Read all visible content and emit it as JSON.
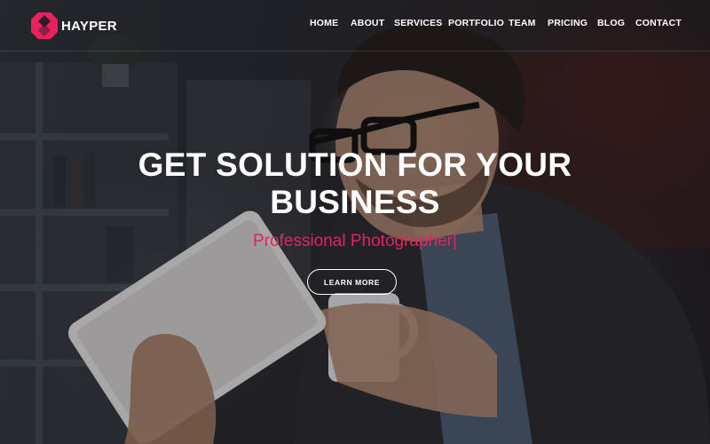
{
  "brand": {
    "name": "HAYPER",
    "logo_icon": "hayper-logo-icon",
    "logo_color": "#e8215f"
  },
  "nav": {
    "items": [
      {
        "label": "HOME"
      },
      {
        "label": "ABOUT"
      },
      {
        "label": "SERVICES"
      },
      {
        "label": "PORTFOLIO"
      },
      {
        "label": "TEAM"
      },
      {
        "label": "PRICING"
      },
      {
        "label": "BLOG"
      },
      {
        "label": "CONTACT"
      }
    ]
  },
  "hero": {
    "headline_line1": "GET SOLUTION FOR YOUR",
    "headline_line2": "BUSINESS",
    "subheading": "Professional Photographer|",
    "cta_label": "LEARN MORE",
    "accent_color": "#e8215f",
    "background": "photo of man with glasses holding tablet and mug"
  }
}
